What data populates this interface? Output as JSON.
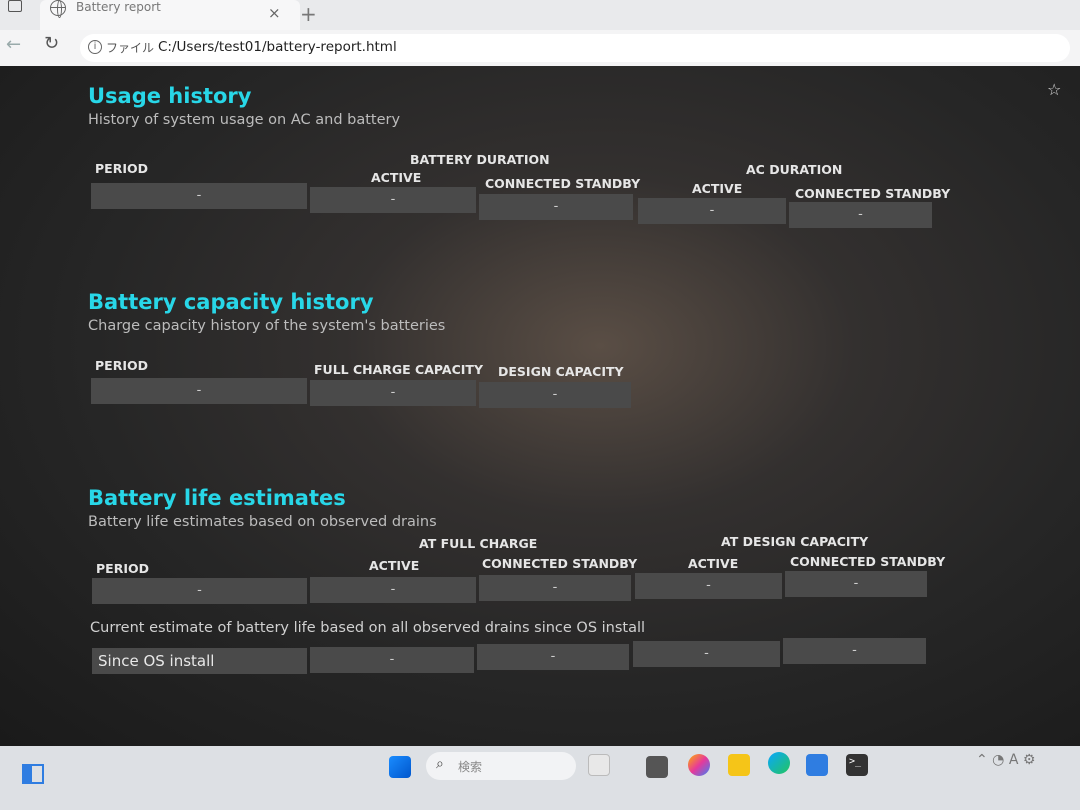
{
  "browser": {
    "tab_title": "Battery report",
    "tab_close": "×",
    "new_tab": "+",
    "file_label": "ファイル",
    "url": "C:/Users/test01/battery-report.html"
  },
  "usage_history": {
    "title": "Usage history",
    "description": "History of system usage on AC and battery",
    "period_header": "PERIOD",
    "battery_duration_header": "BATTERY DURATION",
    "ac_duration_header": "AC DURATION",
    "active_header": "ACTIVE",
    "connected_standby_header": "CONNECTED STANDBY",
    "row": [
      "-",
      "-",
      "-",
      "-",
      "-"
    ]
  },
  "capacity_history": {
    "title": "Battery capacity history",
    "description": "Charge capacity history of the system's batteries",
    "period_header": "PERIOD",
    "full_charge_header": "FULL CHARGE CAPACITY",
    "design_capacity_header": "DESIGN CAPACITY",
    "row": [
      "-",
      "-",
      "-"
    ]
  },
  "life_estimates": {
    "title": "Battery life estimates",
    "description": "Battery life estimates based on observed drains",
    "period_header": "PERIOD",
    "at_full_charge_header": "AT FULL CHARGE",
    "at_design_capacity_header": "AT DESIGN CAPACITY",
    "active_header": "ACTIVE",
    "connected_standby_header": "CONNECTED STANDBY",
    "row": [
      "-",
      "-",
      "-",
      "-",
      "-"
    ],
    "current_estimate_note": "Current estimate of battery life based on all observed drains since OS install",
    "since_os_label": "Since OS install",
    "since_os_row": [
      "-",
      "-",
      "-",
      "-"
    ]
  },
  "taskbar": {
    "search_placeholder": "検索"
  },
  "colors": {
    "section_title": "#28d7e8",
    "background": "#262626",
    "cell": "#4a4a4a"
  }
}
